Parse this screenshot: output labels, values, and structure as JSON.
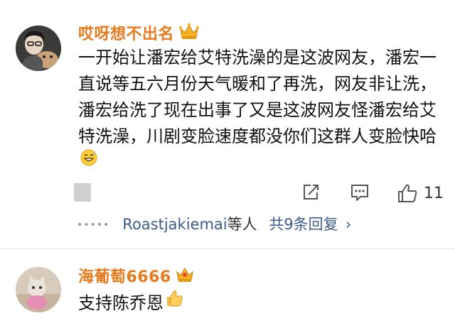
{
  "comments": [
    {
      "username": "哎呀想不出名",
      "text": "一开始让潘宏给艾特洗澡的是这波网友，潘宏一直说等五六月份天气暖和了再洗，网友非让洗，潘宏给洗了现在出事了又是这波网友怪潘宏给艾特洗澡，川剧变脸速度都没你们这群人变脸快哈",
      "like_count": "11",
      "reply_users": "Roastjakiemai",
      "reply_suffix": "等人",
      "reply_count_label": "共9条回复"
    },
    {
      "username": "海葡萄6666",
      "text": "支持陈乔恩"
    }
  ],
  "colors": {
    "username": "#e87a1e",
    "reply_link": "#3c5b8c",
    "crown": "#f5b324"
  }
}
